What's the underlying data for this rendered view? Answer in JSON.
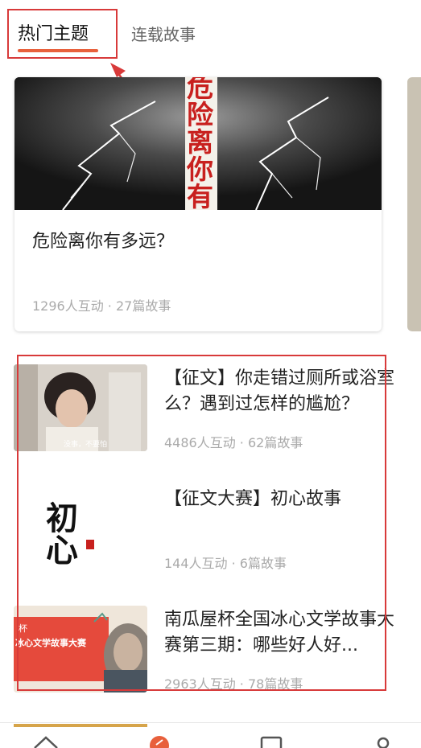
{
  "tabs": {
    "active": "热门主题",
    "inactive": "连载故事"
  },
  "featured": {
    "cover_text": "危险离你有",
    "title": "危险离你有多远？",
    "meta": "1296人互动 · 27篇故事"
  },
  "list": [
    {
      "title": "【征文】你走错过厕所或浴室么？遇到过怎样的尴尬？",
      "meta": "4486人互动 · 62篇故事",
      "thumb_caption": "没事，不要怕"
    },
    {
      "title": "【征文大赛】初心故事",
      "meta": "144人互动 · 6篇故事",
      "thumb_text": "初心"
    },
    {
      "title": "南瓜屋杯全国冰心文学故事大赛第三期：哪些好人好...",
      "meta": "2963人互动 · 78篇故事",
      "thumb_text": "冰心文学故事大赛",
      "thumb_prefix": "杯"
    }
  ],
  "nav": {
    "icons": [
      "home-icon",
      "feather-icon",
      "message-icon",
      "profile-icon"
    ]
  },
  "colors": {
    "accent": "#e8603c",
    "highlight": "#d83a3a"
  }
}
